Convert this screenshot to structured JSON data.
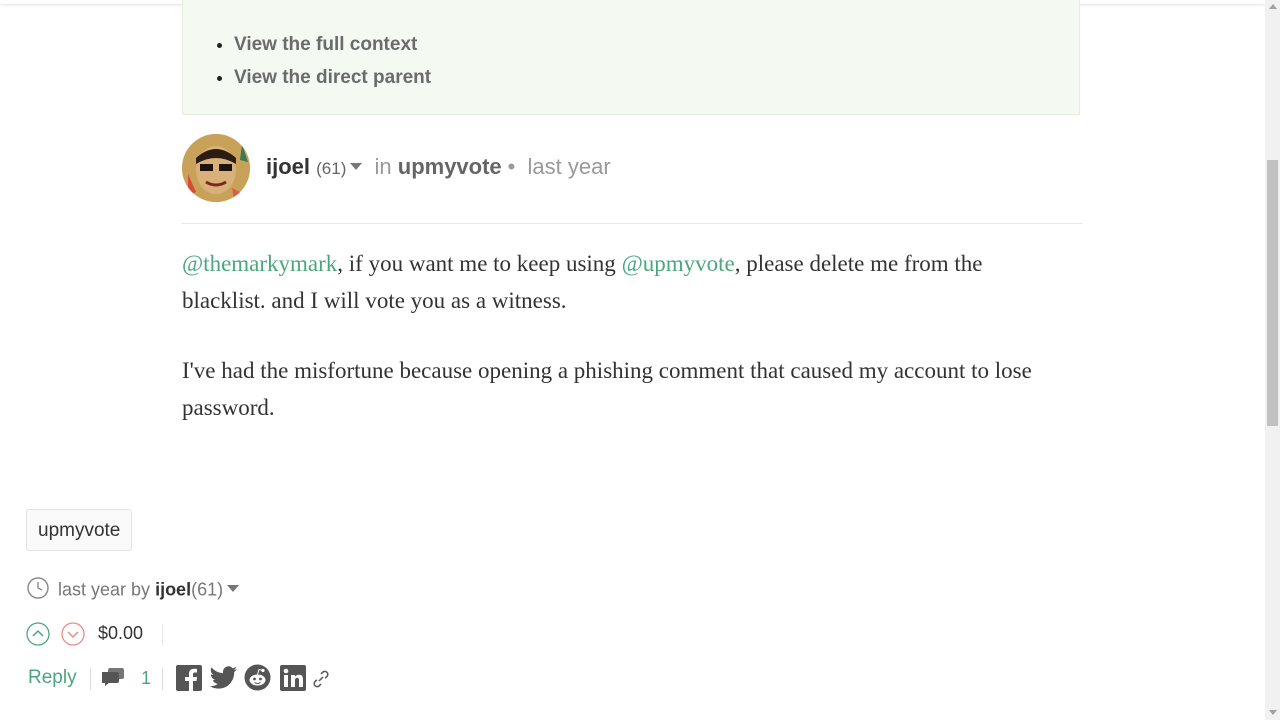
{
  "context_links": [
    "View the full context",
    "View the direct parent"
  ],
  "post": {
    "author": "ijoel",
    "reputation": "(61)",
    "in_label": "in",
    "community": "upmyvote",
    "time": "last year",
    "mention_1": "@themarkymark",
    "text_1a": ", if you want me to keep using ",
    "mention_2": "@upmyvote",
    "text_1b": ", please delete me from the blacklist. and I will vote you as a witness.",
    "text_2": "I've had the misfortune because opening a phishing comment that caused my account to lose password."
  },
  "footer": {
    "tag": "upmyvote",
    "timestamp_prefix": "last year by",
    "author": "ijoel",
    "reputation": "(61)",
    "payout": "$0.00",
    "reply_label": "Reply",
    "comment_count": "1"
  },
  "colors": {
    "accent": "#4ba67f",
    "downvote": "#e88a8a",
    "context_bg": "#f4faf1"
  },
  "icons": [
    "clock-icon",
    "upvote-icon",
    "downvote-icon",
    "comments-icon",
    "facebook-icon",
    "twitter-icon",
    "reddit-icon",
    "linkedin-icon",
    "link-icon",
    "dropdown-caret-icon"
  ]
}
